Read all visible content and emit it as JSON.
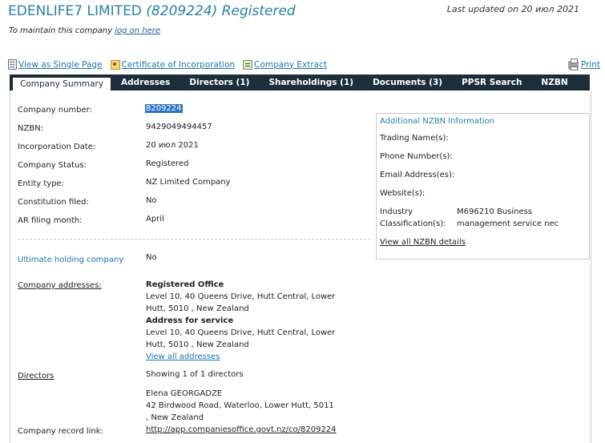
{
  "header": {
    "company_name": "EDENLIFE7 LIMITED",
    "company_number_paren": "(8209224)",
    "status": "Registered",
    "last_updated": "Last updated on 20 июл 2021",
    "maintain_prefix": "To maintain this company",
    "maintain_link": "log on here"
  },
  "top_links": {
    "single_page": "View as Single Page",
    "certificate": "Certificate of Incorporation",
    "extract": "Company Extract",
    "print": "Print"
  },
  "tabs": [
    {
      "label": "Company Summary"
    },
    {
      "label": "Addresses"
    },
    {
      "label": "Directors (1)"
    },
    {
      "label": "Shareholdings (1)"
    },
    {
      "label": "Documents (3)"
    },
    {
      "label": "PPSR Search"
    },
    {
      "label": "NZBN"
    }
  ],
  "summary": [
    {
      "label": "Company number:",
      "value": "8209224"
    },
    {
      "label": "NZBN:",
      "value": "9429049494457"
    },
    {
      "label": "Incorporation Date:",
      "value": "20 июл 2021"
    },
    {
      "label": "Company Status:",
      "value": "Registered"
    },
    {
      "label": "Entity type:",
      "value": "NZ Limited Company"
    },
    {
      "label": "Constitution filed:",
      "value": "No"
    },
    {
      "label": "AR filing month:",
      "value": "April"
    }
  ],
  "nzbn_box": {
    "title": "Additional NZBN Information",
    "trading": "Trading Name(s):",
    "phone": "Phone Number(s):",
    "email": "Email Address(es):",
    "website": "Website(s):",
    "industry_label_1": "Industry",
    "industry_label_2": "Classification(s):",
    "industry_value_1": "M696210 Business",
    "industry_value_2": "management service nec",
    "view_all": "View all NZBN details"
  },
  "holding": {
    "label": "Ultimate holding company",
    "value": "No"
  },
  "addresses": {
    "label": "Company addresses:",
    "registered_title": "Registered Office",
    "registered_line1": "Level 10, 40 Queens Drive, Hutt Central, Lower",
    "registered_line2": "Hutt, 5010 , New Zealand",
    "service_title": "Address for service",
    "service_line1": "Level 10, 40 Queens Drive, Hutt Central, Lower",
    "service_line2": "Hutt, 5010 , New Zealand",
    "view_all": "View all addresses"
  },
  "directors": {
    "label": "Directors",
    "showing": "Showing 1 of 1 directors",
    "name": "Elena GEORGADZE",
    "addr_line1": "42 Birdwood Road, Waterloo, Lower Hutt, 5011",
    "addr_line2": ", New Zealand"
  },
  "record": {
    "label": "Company record link:",
    "url": "http://app.companiesoffice.govt.nz/co/8209224"
  }
}
